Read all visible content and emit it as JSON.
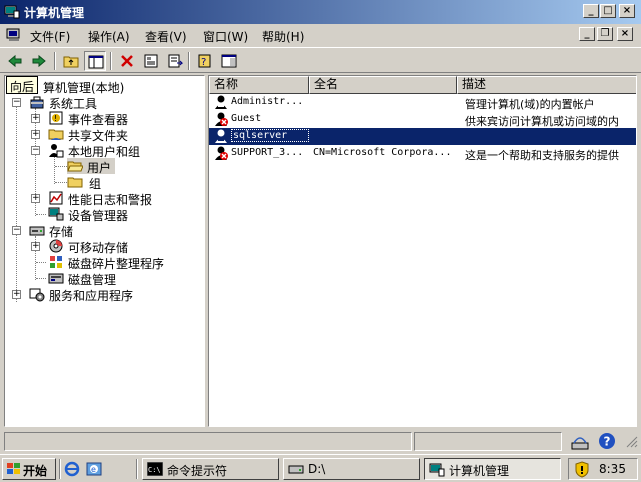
{
  "window": {
    "title": "计算机管理"
  },
  "menu": {
    "file": "文件(F)",
    "action": "操作(A)",
    "view": "查看(V)",
    "window": "窗口(W)",
    "help": "帮助(H)"
  },
  "tooltip": "向后",
  "tree": {
    "root": "算机管理(本地)",
    "system_tools": "系统工具",
    "event_viewer": "事件查看器",
    "shared_folders": "共享文件夹",
    "local_users_groups": "本地用户和组",
    "users": "用户",
    "groups": "组",
    "perf_logs": "性能日志和警报",
    "device_manager": "设备管理器",
    "storage": "存储",
    "removable_storage": "可移动存储",
    "disk_defrag": "磁盘碎片整理程序",
    "disk_management": "磁盘管理",
    "services_apps": "服务和应用程序"
  },
  "list": {
    "columns": [
      "名称",
      "全名",
      "描述"
    ],
    "rows": [
      {
        "name": "Administr...",
        "fullname": "",
        "desc": "管理计算机(域)的内置帐户",
        "disabled": false
      },
      {
        "name": "Guest",
        "fullname": "",
        "desc": "供来宾访问计算机或访问域的内",
        "disabled": true
      },
      {
        "name": "sqlserver",
        "fullname": "",
        "desc": "",
        "disabled": false,
        "selected": true
      },
      {
        "name": "SUPPORT_3...",
        "fullname": "CN=Microsoft Corpora...",
        "desc": "这是一个帮助和支持服务的提供",
        "disabled": true
      }
    ]
  },
  "taskbar": {
    "start": "开始",
    "cmd": "命令提示符",
    "drive": "D:\\",
    "computer_mgmt": "计算机管理",
    "clock": "8:35"
  },
  "colors": {
    "title_start": "#0a246a",
    "title_end": "#a6caf0",
    "selection": "#0a246a",
    "face": "#d4d0c8"
  }
}
